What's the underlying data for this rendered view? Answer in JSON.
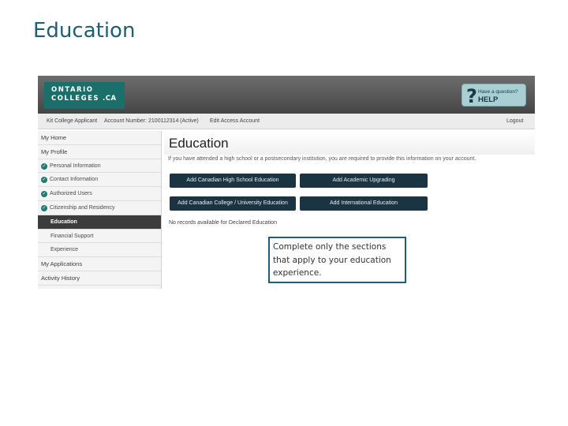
{
  "slide": {
    "title": "Education",
    "callout_text": "Complete only the sections that apply to your education experience."
  },
  "header": {
    "logo_line1": "ONTARIO",
    "logo_line2": "COLLEGES",
    "logo_suffix": ".CA",
    "help_small": "Have a question?",
    "help_big": "HELP",
    "help_mark": "?"
  },
  "account_bar": {
    "user": "Kit College Applicant",
    "account_number": "Account Number: 2100112314",
    "status": "(Active)",
    "edit_link": "Edit Access Account",
    "logout": "Logout"
  },
  "sidebar": {
    "items": [
      {
        "label": "My Home"
      },
      {
        "label": "My Profile"
      },
      {
        "label": "Personal Information"
      },
      {
        "label": "Contact Information"
      },
      {
        "label": "Authorized Users"
      },
      {
        "label": "Citizenship and Residency"
      },
      {
        "label": "Education"
      },
      {
        "label": "Financial Support"
      },
      {
        "label": "Experience"
      },
      {
        "label": "My Applications"
      },
      {
        "label": "Activity History"
      }
    ]
  },
  "main": {
    "title": "Education",
    "intro": "If you have attended a high school or a postsecondary institution, you are required to provide this information on your account.",
    "buttons": {
      "high_school": "Add Canadian High School Education",
      "academic_upgrading": "Add Academic Upgrading",
      "college_university": "Add Canadian College / University Education",
      "international": "Add International Education"
    },
    "no_records": "No records available for Declared Education"
  },
  "colors": {
    "title": "#1f5f73",
    "logo_bg": "#1b6f6a",
    "button_bg": "#1b3442",
    "help_bg": "#a9cfd3"
  }
}
